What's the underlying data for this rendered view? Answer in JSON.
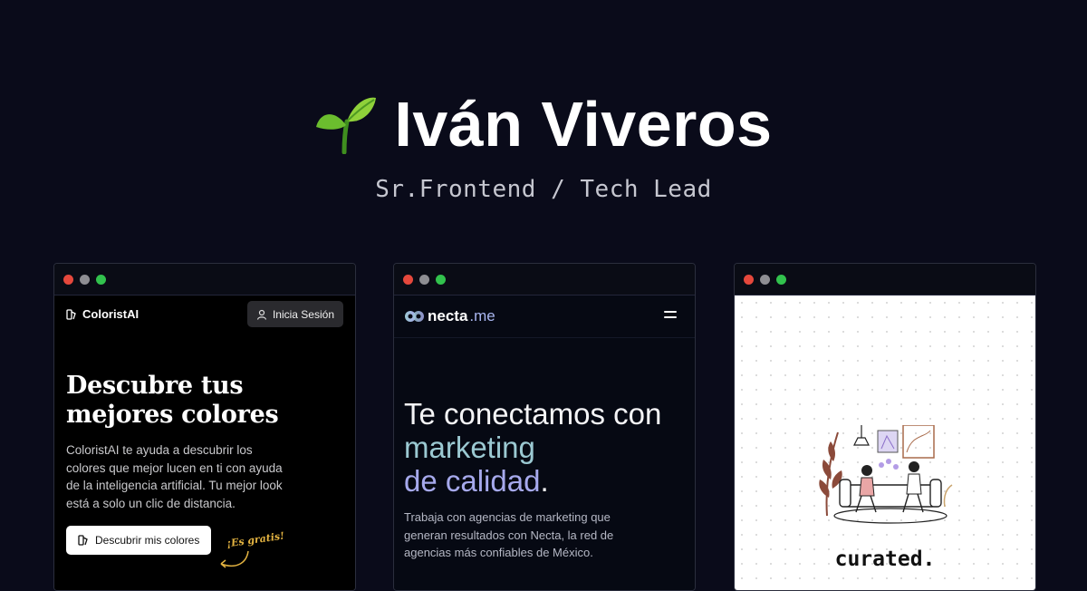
{
  "header": {
    "sprout_icon": "seedling-emoji",
    "name": "Iván Viveros",
    "subtitle": "Sr.Frontend / Tech Lead"
  },
  "colors": {
    "background": "#0a0b1a",
    "red_dot": "#e5483c",
    "gray_dot": "#8e8e93",
    "green_dot": "#32c24d",
    "accent_yellow": "#e3b341",
    "necta_gradient_start": "#9bc9d2",
    "necta_gradient_end": "#a6a9ec"
  },
  "projects": {
    "colorist": {
      "logo": "ColoristAI",
      "login_label": "Inicia Sesión",
      "title_line1": "Descubre tus",
      "title_line2": "mejores colores",
      "description": "ColoristAI te ayuda a descubrir los colores que mejor lucen en ti con ayuda de la inteligencia artificial. Tu mejor look está a solo un clic de distancia.",
      "cta_label": "Descubrir mis colores",
      "free_label": "¡Es gratis!"
    },
    "necta": {
      "logo_main": "necta",
      "logo_suffix": ".me",
      "headline_part1": "Te conectamos con ",
      "headline_highlight1": "marketing",
      "headline_highlight2": "de calidad",
      "headline_end": ".",
      "description": "Trabaja con agencias de marketing que generan resultados con Necta, la red de agencias más confiables de México."
    },
    "curated": {
      "brand": "curated."
    }
  }
}
